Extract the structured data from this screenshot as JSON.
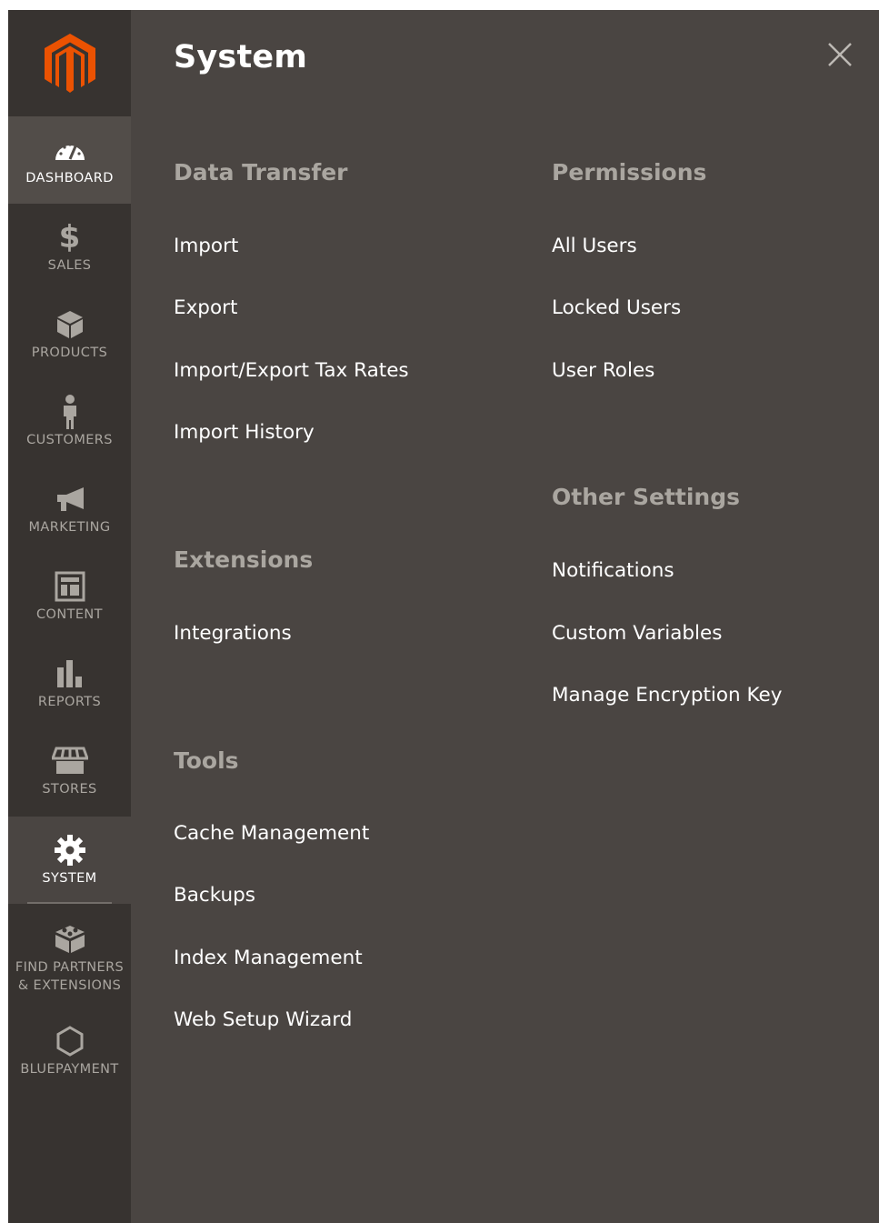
{
  "sidebar": {
    "items": [
      {
        "label": "DASHBOARD",
        "icon": "dashboard-icon"
      },
      {
        "label": "SALES",
        "icon": "dollar-icon"
      },
      {
        "label": "PRODUCTS",
        "icon": "box-icon"
      },
      {
        "label": "CUSTOMERS",
        "icon": "person-icon"
      },
      {
        "label": "MARKETING",
        "icon": "megaphone-icon"
      },
      {
        "label": "CONTENT",
        "icon": "layout-icon"
      },
      {
        "label": "REPORTS",
        "icon": "bar-chart-icon"
      },
      {
        "label": "STORES",
        "icon": "storefront-icon"
      },
      {
        "label": "SYSTEM",
        "icon": "gear-icon"
      },
      {
        "label_line1": "FIND PARTNERS",
        "label_line2": "& EXTENSIONS",
        "icon": "blocks-icon"
      },
      {
        "label": "BLUEPAYMENT",
        "icon": "hexagon-icon"
      }
    ]
  },
  "panel": {
    "title": "System",
    "groups": {
      "data_transfer": {
        "title": "Data Transfer",
        "links": [
          "Import",
          "Export",
          "Import/Export Tax Rates",
          "Import History"
        ]
      },
      "extensions": {
        "title": "Extensions",
        "links": [
          "Integrations"
        ]
      },
      "tools": {
        "title": "Tools",
        "links": [
          "Cache Management",
          "Backups",
          "Index Management",
          "Web Setup Wizard"
        ]
      },
      "permissions": {
        "title": "Permissions",
        "links": [
          "All Users",
          "Locked Users",
          "User Roles"
        ]
      },
      "other_settings": {
        "title": "Other Settings",
        "links": [
          "Notifications",
          "Custom Variables",
          "Manage Encryption Key"
        ]
      }
    }
  },
  "colors": {
    "sidebar_bg": "#373330",
    "panel_bg": "#4a4542",
    "logo_orange": "#eb5202",
    "muted_text": "#aaa6a0"
  }
}
